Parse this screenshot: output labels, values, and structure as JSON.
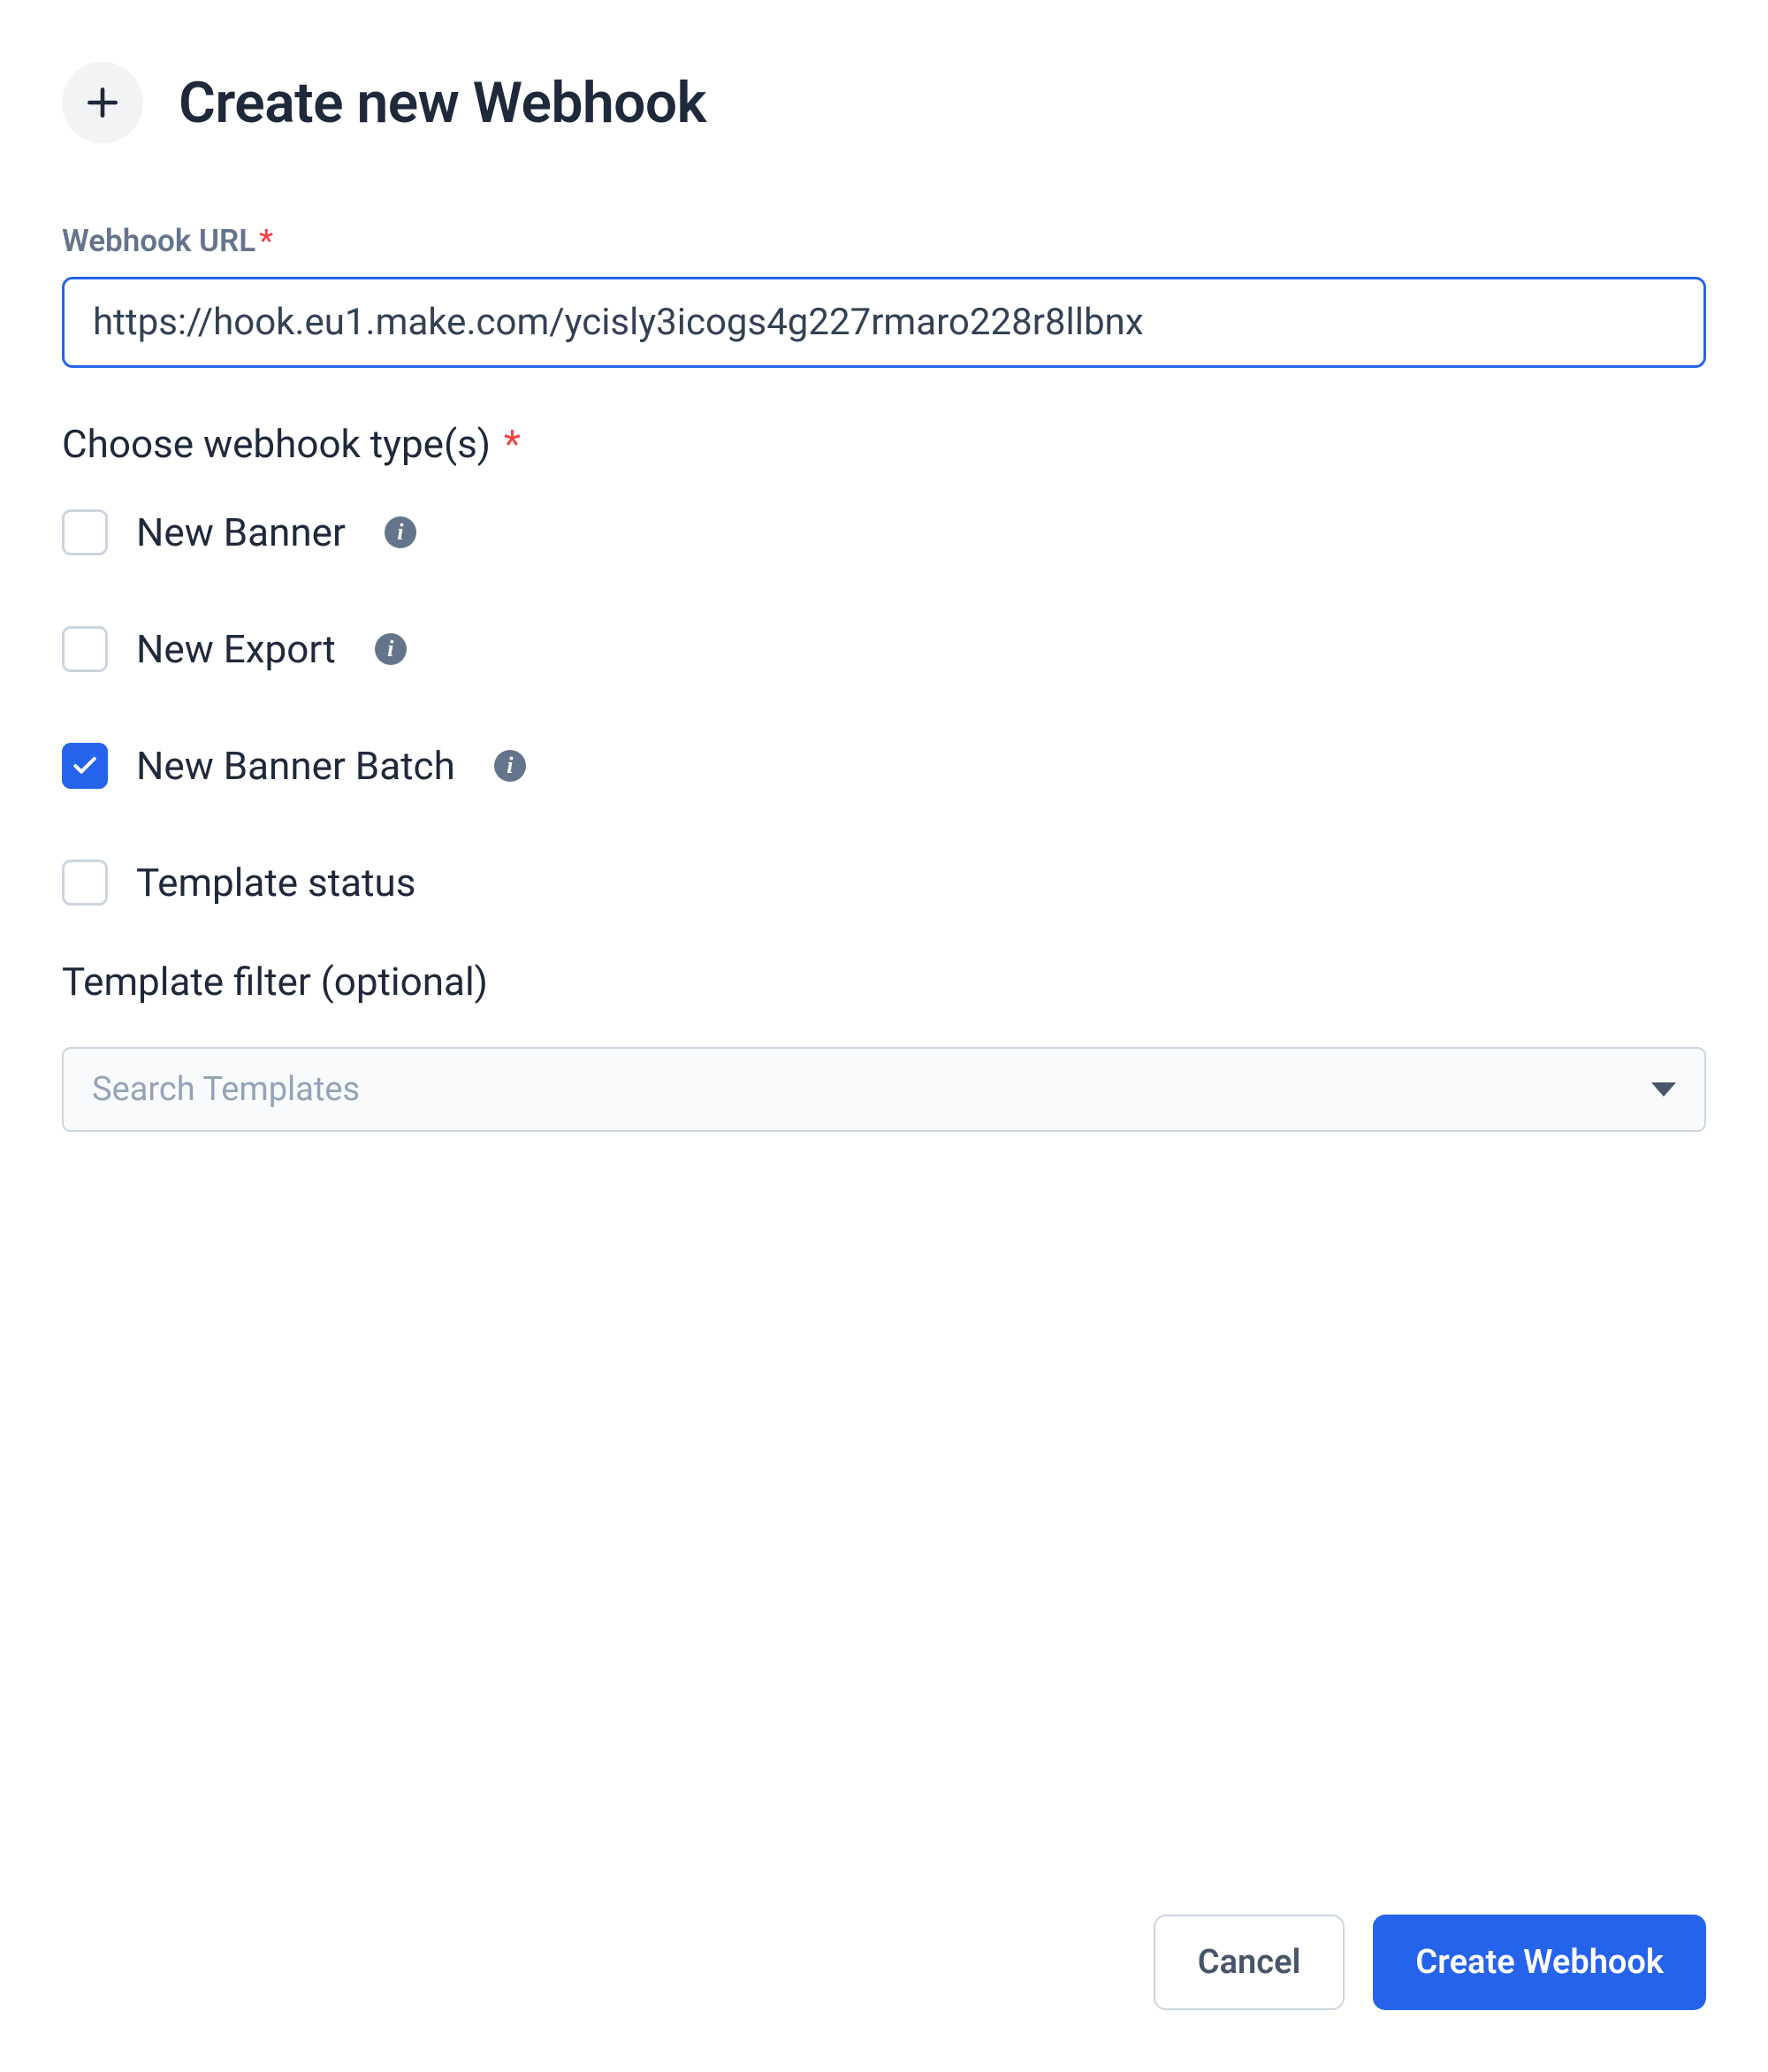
{
  "header": {
    "title": "Create new Webhook"
  },
  "url_field": {
    "label": "Webhook URL",
    "value": "https://hook.eu1.make.com/ycisly3icogs4g227rmaro228r8llbnx"
  },
  "types_section": {
    "label": "Choose webhook type(s)"
  },
  "checkboxes": [
    {
      "label": "New Banner",
      "checked": false,
      "has_info": true
    },
    {
      "label": "New Export",
      "checked": false,
      "has_info": true
    },
    {
      "label": "New Banner Batch",
      "checked": true,
      "has_info": true
    },
    {
      "label": "Template status",
      "checked": false,
      "has_info": false
    }
  ],
  "template_filter": {
    "label": "Template filter (optional)",
    "placeholder": "Search Templates"
  },
  "footer": {
    "cancel_label": "Cancel",
    "submit_label": "Create Webhook"
  }
}
